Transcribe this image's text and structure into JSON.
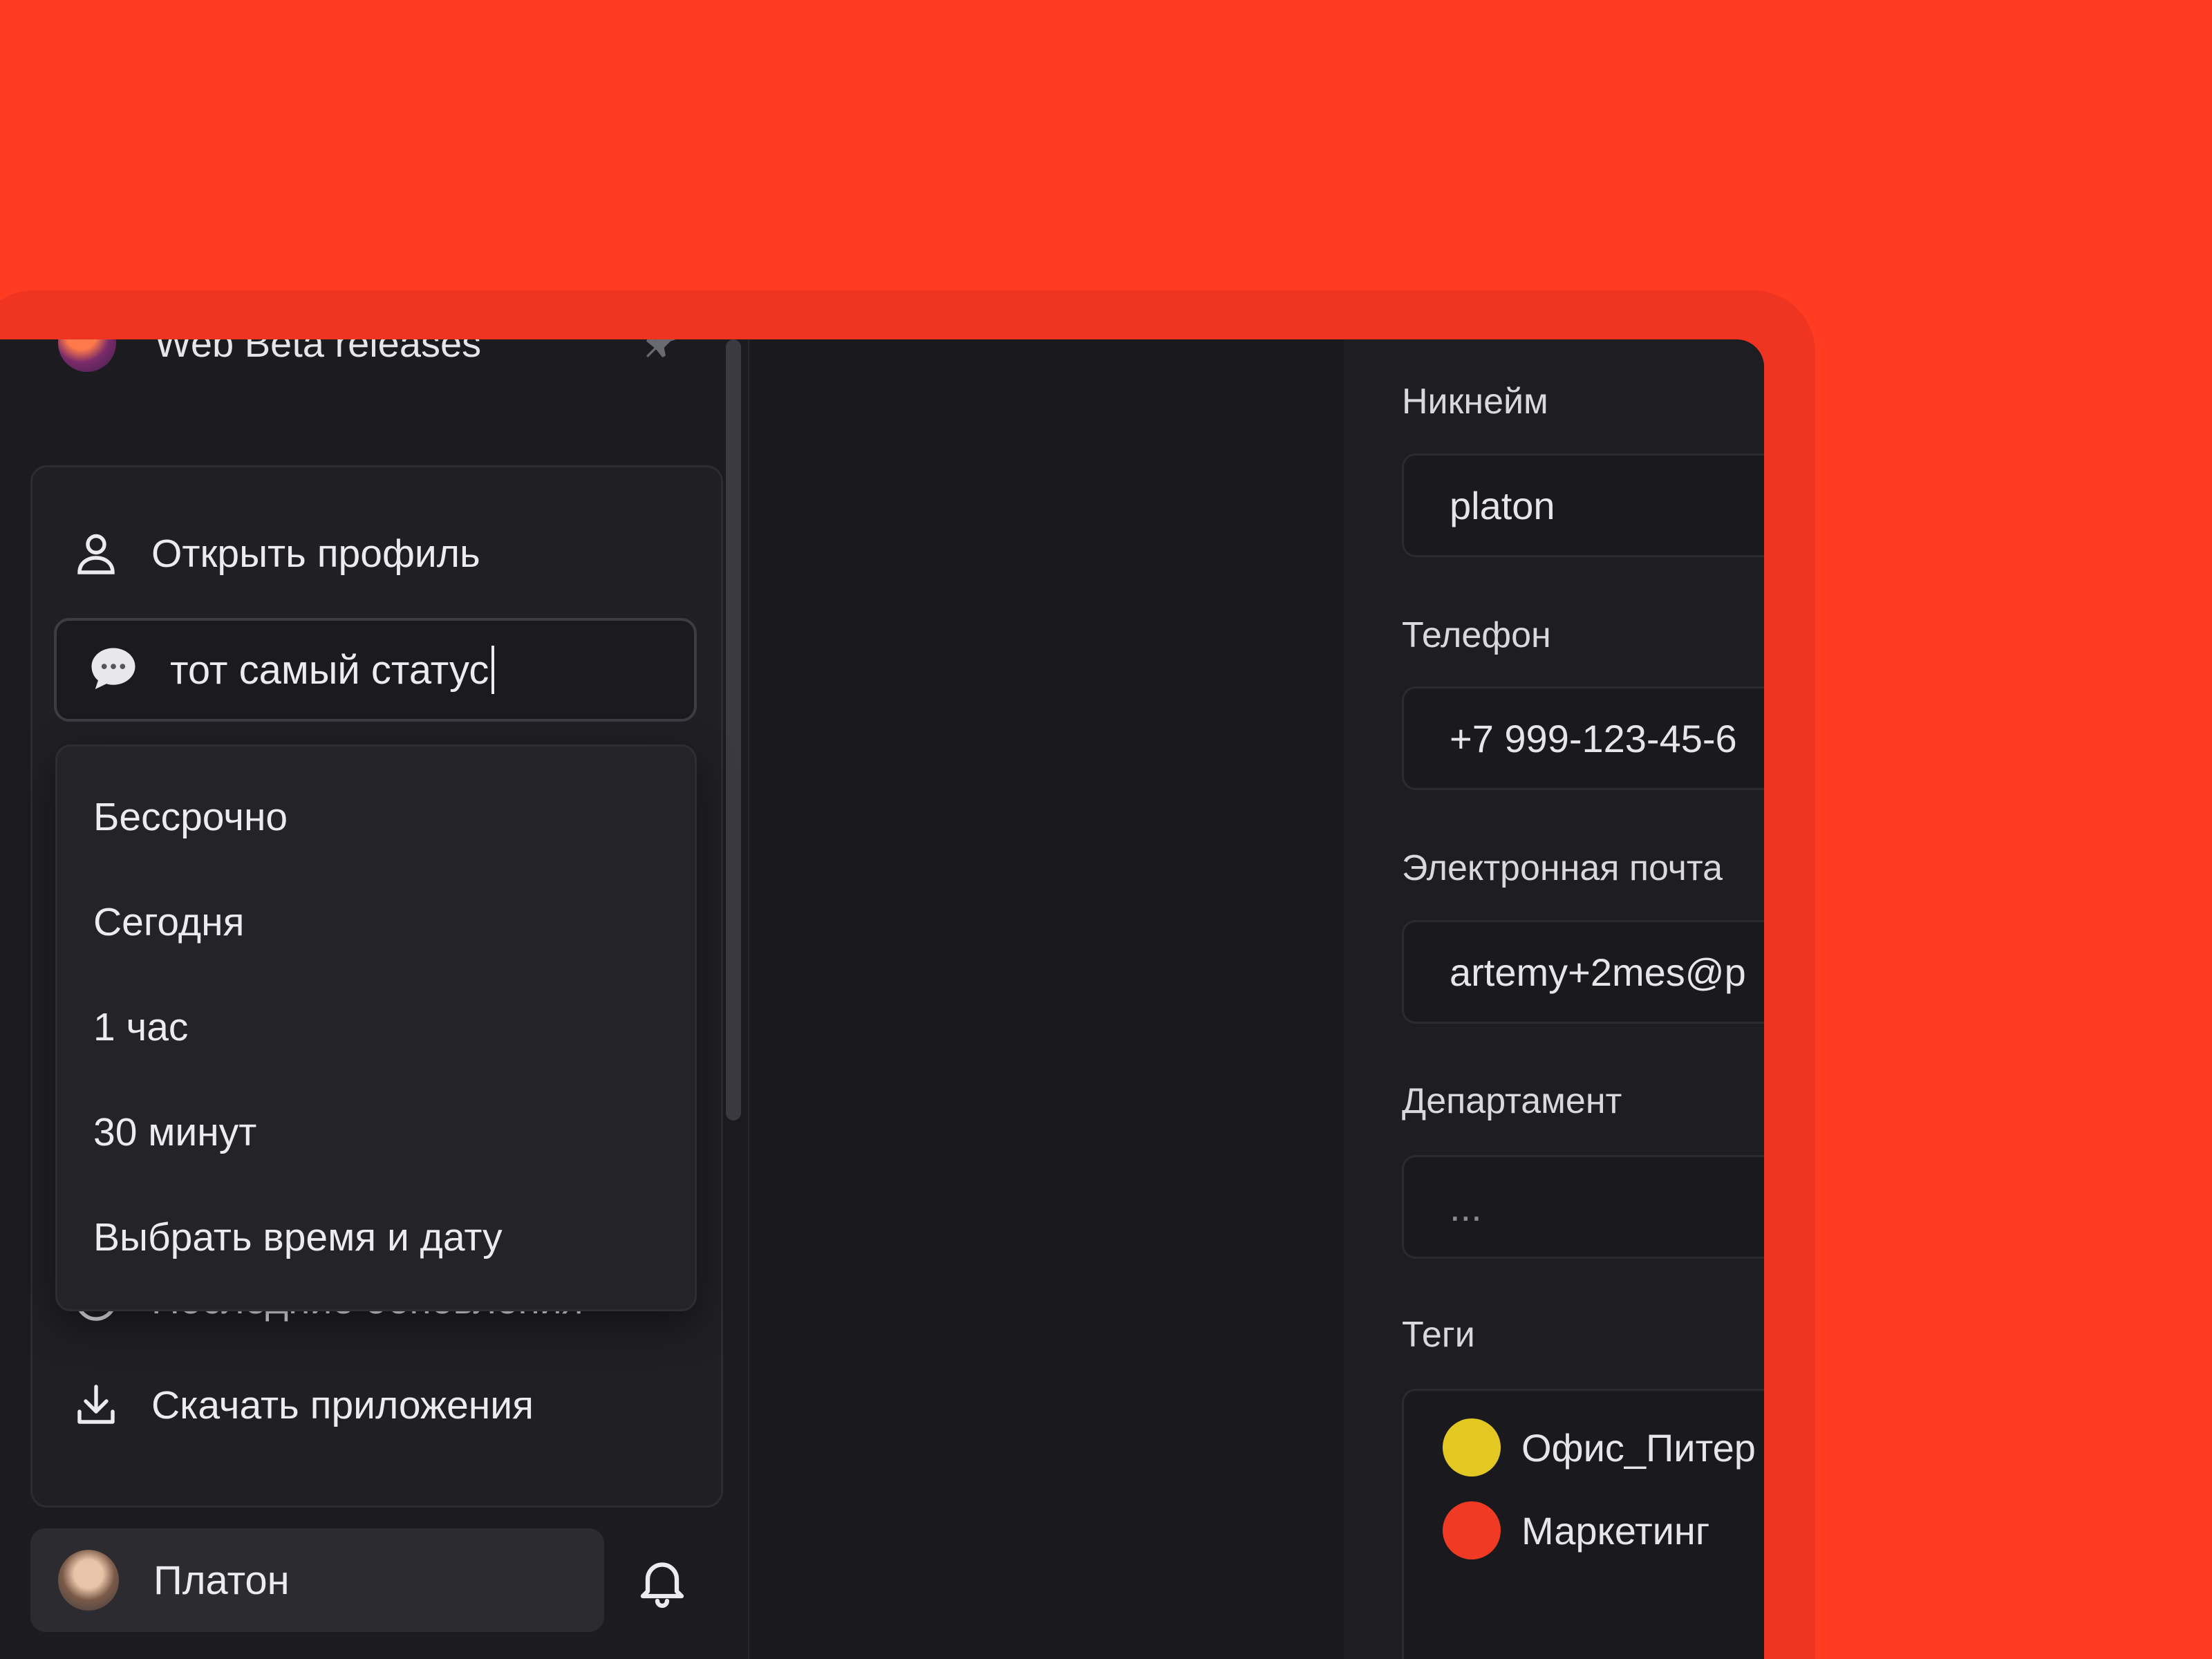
{
  "channel": {
    "name": "Web Beta releases"
  },
  "menu": {
    "open_profile": "Открыть профиль",
    "recent_updates": "Последние обновления",
    "download_apps": "Скачать приложения"
  },
  "status_input": {
    "value": "тот самый статус"
  },
  "duration_options": [
    "Бессрочно",
    "Сегодня",
    "1 час",
    "30 минут",
    "Выбрать время и дату"
  ],
  "user": {
    "name": "Платон"
  },
  "profile_fields": {
    "nickname": {
      "label": "Никнейм",
      "value": "platon"
    },
    "phone": {
      "label": "Телефон",
      "value": "+7 999-123-45-6"
    },
    "email": {
      "label": "Электронная почта",
      "value": "artemy+2mes@p"
    },
    "department": {
      "label": "Департамент",
      "value": "..."
    },
    "tags": {
      "label": "Теги",
      "items": [
        {
          "label": "Офис_Питер",
          "color": "#e3c823"
        },
        {
          "label": "Маркетинг",
          "color": "#f03a24"
        }
      ]
    }
  },
  "colors": {
    "background_accent": "#ff3b22",
    "window_bg": "#1a1a1e",
    "text_primary": "#ececef"
  },
  "icons": {
    "profile": "user-icon",
    "status": "speech-bubble-icon",
    "recent": "clock-icon",
    "download": "download-icon",
    "notifications": "bell-icon",
    "pin": "pin-icon"
  }
}
